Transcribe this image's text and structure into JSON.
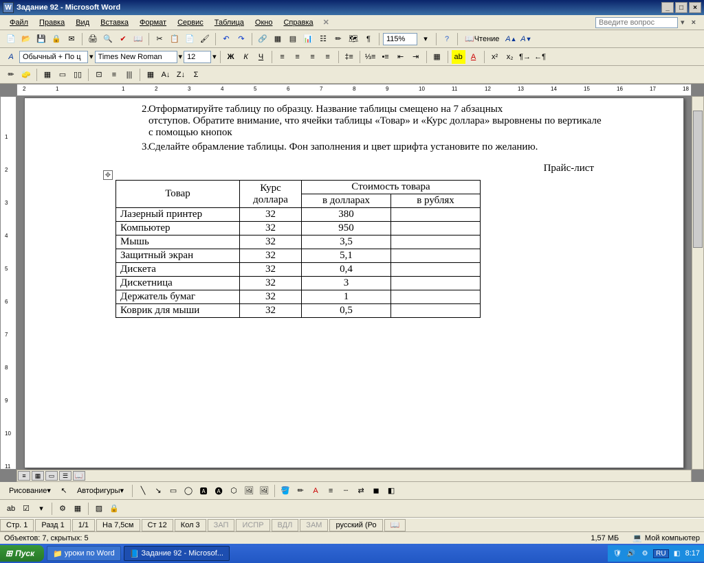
{
  "window": {
    "title": "Задание 92 - Microsoft Word",
    "app_icon": "W"
  },
  "menu": {
    "file": "Файл",
    "edit": "Правка",
    "view": "Вид",
    "insert": "Вставка",
    "format": "Формат",
    "tools": "Сервис",
    "table": "Таблица",
    "window": "Окно",
    "help": "Справка",
    "search_placeholder": "Введите вопрос"
  },
  "toolbar": {
    "zoom": "115%",
    "reading": "Чтение"
  },
  "fmtbar": {
    "style_A": "A",
    "style": "Обычный + По ц",
    "font": "Times New Roman",
    "size": "12",
    "bold": "Ж",
    "italic": "К",
    "underline": "Ч"
  },
  "drawbar": {
    "drawing": "Рисование",
    "autoshapes": "Автофигуры"
  },
  "document": {
    "list_num_2": "2.",
    "para2_cut": "Отформатируйте таблицу по образцу. Название таблицы смещено на 7 абзацных",
    "para2_rest": "отступов. Обратите внимание, что ячейки таблицы «Товар» и «Курс доллара» выровнены по вертикале с помощью кнопок",
    "list_num_3": "3.",
    "para3": "Сделайте обрамление таблицы. Фон заполнения и цвет шрифта установите по желанию.",
    "pricelist": "Прайс-лист",
    "table": {
      "headers": {
        "product": "Товар",
        "rate": "Курс доллара",
        "cost": "Стоимость товара",
        "usd": "в долларах",
        "rub": "в рублях"
      },
      "rows": [
        {
          "name": "Лазерный принтер",
          "rate": "32",
          "usd": "380",
          "rub": ""
        },
        {
          "name": "Компьютер",
          "rate": "32",
          "usd": "950",
          "rub": ""
        },
        {
          "name": "Мышь",
          "rate": "32",
          "usd": "3,5",
          "rub": ""
        },
        {
          "name": "Защитный экран",
          "rate": "32",
          "usd": "5,1",
          "rub": ""
        },
        {
          "name": "Дискета",
          "rate": "32",
          "usd": "0,4",
          "rub": ""
        },
        {
          "name": "Дискетница",
          "rate": "32",
          "usd": "3",
          "rub": ""
        },
        {
          "name": "Держатель бумаг",
          "rate": "32",
          "usd": "1",
          "rub": ""
        },
        {
          "name": "Коврик для мыши",
          "rate": "32",
          "usd": "0,5",
          "rub": ""
        }
      ]
    }
  },
  "status": {
    "page": "Стр. 1",
    "section": "Разд 1",
    "pages": "1/1",
    "at": "На 7,5см",
    "line": "Ст 12",
    "col": "Кол 3",
    "rec": "ЗАП",
    "trk": "ИСПР",
    "ext": "ВДЛ",
    "ovr": "ЗАМ",
    "lang": "русский (Ро"
  },
  "objects": {
    "label": "Объектов: 7, скрытых: 5",
    "size": "1,57 МБ",
    "mycomputer": "Мой компьютер"
  },
  "taskbar": {
    "start": "Пуск",
    "task1": "уроки по Word",
    "task2": "Задание 92 - Microsof...",
    "lang": "RU",
    "time": "8:17"
  },
  "ruler_h": [
    "2",
    "1",
    "",
    "1",
    "2",
    "3",
    "4",
    "5",
    "6",
    "7",
    "8",
    "9",
    "10",
    "11",
    "12",
    "13",
    "14",
    "15",
    "16",
    "17",
    "18"
  ],
  "ruler_v": [
    "",
    "1",
    "2",
    "3",
    "4",
    "5",
    "6",
    "7",
    "8",
    "9",
    "10",
    "11"
  ]
}
